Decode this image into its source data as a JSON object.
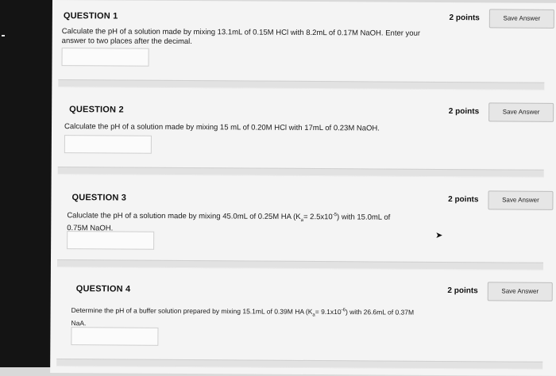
{
  "questions": [
    {
      "title": "QUESTION 1",
      "points": "2 points",
      "save_label": "Save Answer",
      "text": "Calculate the pH of a solution made by mixing 13.1mL of 0.15M HCl with 8.2mL of 0.17M NaOH.  Enter your answer to two places after the decimal."
    },
    {
      "title": "QUESTION 2",
      "points": "2 points",
      "save_label": "Save Answer",
      "text": "Calculate the pH of a solution made by mixing 15 mL of 0.20M HCl with 17mL of 0.23M NaOH."
    },
    {
      "title": "QUESTION 3",
      "points": "2 points",
      "save_label": "Save Answer",
      "text_before": "Caluclate the pH of a solution made by mixing 45.0mL of 0.25M HA (K",
      "sub": "a",
      "text_mid": "= 2.5x10",
      "sup": "-5",
      "text_after": ") with 15.0mL of 0.75M NaOH."
    },
    {
      "title": "QUESTION 4",
      "points": "2 points",
      "save_label": "Save Answer",
      "text_before": "Determine the pH of a buffer solution prepared by mixing 15.1mL of 0.39M HA (K",
      "sub": "a",
      "text_mid": "= 9.1x10",
      "sup": "-6",
      "text_after": ") with 26.6mL of 0.37M NaA."
    }
  ]
}
